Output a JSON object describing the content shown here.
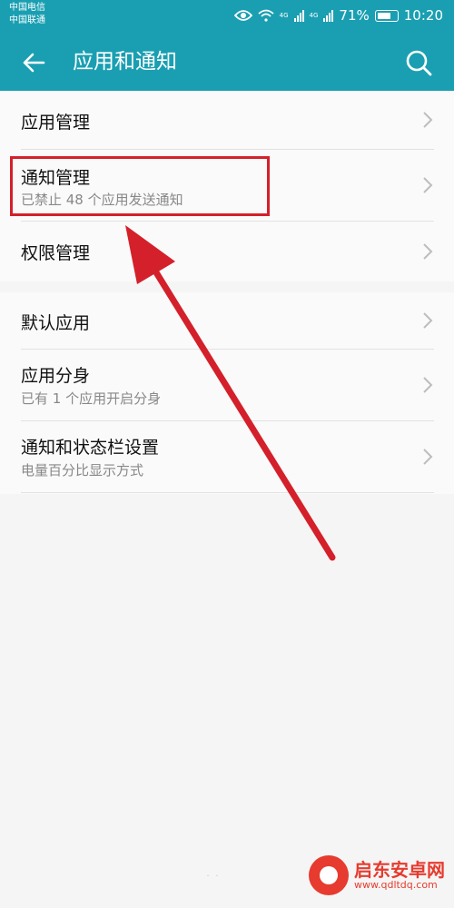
{
  "status_bar": {
    "carrier_1": "中国电信",
    "carrier_2": "中国联通",
    "net_1": "4G",
    "net_2": "4G",
    "battery": "71%",
    "time": "10:20"
  },
  "app_bar": {
    "title": "应用和通知",
    "back_icon": "back-arrow-icon",
    "search_icon": "search-icon",
    "color": "#1a9fb2"
  },
  "groups": [
    {
      "items": [
        {
          "label": "应用管理",
          "subtitle": ""
        },
        {
          "label": "通知管理",
          "subtitle": "已禁止 48 个应用发送通知"
        },
        {
          "label": "权限管理",
          "subtitle": ""
        }
      ]
    },
    {
      "items": [
        {
          "label": "默认应用",
          "subtitle": ""
        },
        {
          "label": "应用分身",
          "subtitle": "已有 1 个应用开启分身"
        },
        {
          "label": "通知和状态栏设置",
          "subtitle": "电量百分比显示方式"
        }
      ]
    }
  ],
  "annotation": {
    "highlight_color": "#d4202a",
    "arrow_color": "#d4202a"
  },
  "watermark": {
    "name": "启东安卓网",
    "url": "www.qdltdq.com",
    "color": "#e63b2e"
  }
}
